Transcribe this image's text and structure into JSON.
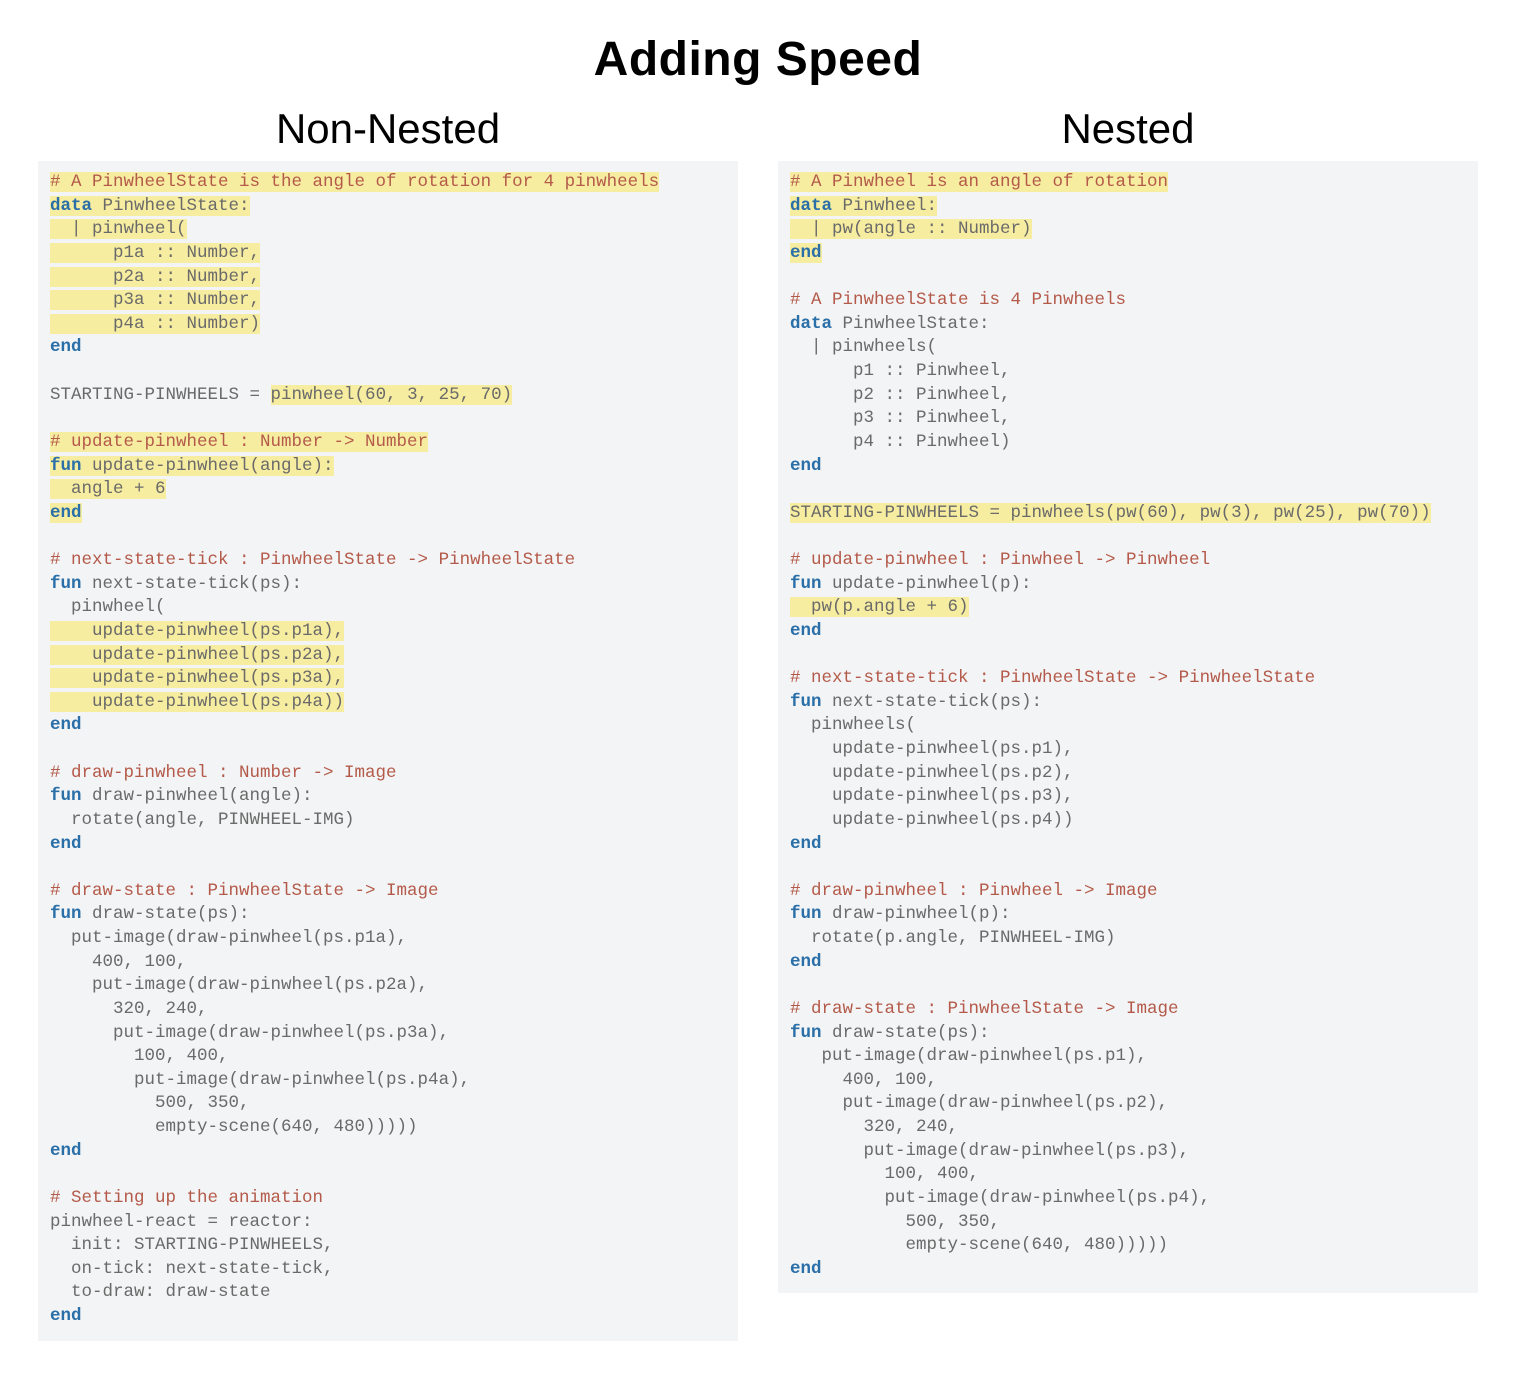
{
  "title": "Adding Speed",
  "left": {
    "heading": "Non-Nested",
    "l01": "# A PinwheelState is the angle of rotation for 4 pinwheels",
    "l02a": "data",
    "l02b": " PinwheelState:",
    "l03": "  | pinwheel(",
    "l04": "      p1a :: Number,",
    "l05": "      p2a :: Number,",
    "l06": "      p3a :: Number,",
    "l07": "      p4a :: Number)",
    "l08": "end",
    "l09a": "STARTING-PINWHEELS = ",
    "l09b": "pinwheel(60, 3, 25, 70)",
    "l10": "# update-pinwheel : Number -> Number",
    "l11a": "fun",
    "l11b": " update-pinwheel(angle):",
    "l12": "  angle + 6",
    "l13": "end",
    "l14": "# next-state-tick : PinwheelState -> PinwheelState",
    "l15a": "fun",
    "l15b": " next-state-tick(ps):",
    "l16": "  pinwheel(",
    "l17": "    update-pinwheel(ps.p1a),",
    "l18": "    update-pinwheel(ps.p2a),",
    "l19": "    update-pinwheel(ps.p3a),",
    "l20": "    update-pinwheel(ps.p4a))",
    "l21": "end",
    "l22": "# draw-pinwheel : Number -> Image",
    "l23a": "fun",
    "l23b": " draw-pinwheel(angle):",
    "l24": "  rotate(angle, PINWHEEL-IMG)",
    "l25": "end",
    "l26": "# draw-state : PinwheelState -> Image",
    "l27a": "fun",
    "l27b": " draw-state(ps):",
    "l28": "  put-image(draw-pinwheel(ps.p1a),",
    "l29": "    400, 100,",
    "l30": "    put-image(draw-pinwheel(ps.p2a),",
    "l31": "      320, 240,",
    "l32": "      put-image(draw-pinwheel(ps.p3a),",
    "l33": "        100, 400,",
    "l34": "        put-image(draw-pinwheel(ps.p4a),",
    "l35": "          500, 350,",
    "l36": "          empty-scene(640, 480)))))",
    "l37": "end",
    "l38": "# Setting up the animation",
    "l39": "pinwheel-react = reactor:",
    "l40": "  init: STARTING-PINWHEELS,",
    "l41": "  on-tick: next-state-tick,",
    "l42": "  to-draw: draw-state",
    "l43": "end"
  },
  "right": {
    "heading": "Nested",
    "l01": "# A Pinwheel is an angle of rotation",
    "l02a": "data",
    "l02b": " Pinwheel:",
    "l03": "  | pw(angle :: Number)",
    "l04": "end",
    "l05": "# A PinwheelState is 4 Pinwheels",
    "l06a": "data",
    "l06b": " PinwheelState:",
    "l07": "  | pinwheels(",
    "l08": "      p1 :: Pinwheel,",
    "l09": "      p2 :: Pinwheel,",
    "l10": "      p3 :: Pinwheel,",
    "l11": "      p4 :: Pinwheel)",
    "l12": "end",
    "l13a": "STARTING-PINWHEELS = ",
    "l13b": "pinwheels(pw(60), pw(3), pw(25), pw(70))",
    "l14": "# update-pinwheel : Pinwheel -> Pinwheel",
    "l15a": "fun",
    "l15b": " update-pinwheel(p):",
    "l16": "  pw(p.angle + 6)",
    "l17": "end",
    "l18": "# next-state-tick : PinwheelState -> PinwheelState",
    "l19a": "fun",
    "l19b": " next-state-tick(ps):",
    "l20": "  pinwheels(",
    "l21": "    update-pinwheel(ps.p1),",
    "l22": "    update-pinwheel(ps.p2),",
    "l23": "    update-pinwheel(ps.p3),",
    "l24": "    update-pinwheel(ps.p4))",
    "l25": "end",
    "l26": "# draw-pinwheel : Pinwheel -> Image",
    "l27a": "fun",
    "l27b": " draw-pinwheel(p):",
    "l28": "  rotate(p.angle, PINWHEEL-IMG)",
    "l29": "end",
    "l30": "# draw-state : PinwheelState -> Image",
    "l31a": "fun",
    "l31b": " draw-state(ps):",
    "l32": "   put-image(draw-pinwheel(ps.p1),",
    "l33": "     400, 100,",
    "l34": "     put-image(draw-pinwheel(ps.p2),",
    "l35": "       320, 240,",
    "l36": "       put-image(draw-pinwheel(ps.p3),",
    "l37": "         100, 400,",
    "l38": "         put-image(draw-pinwheel(ps.p4),",
    "l39": "           500, 350,",
    "l40": "           empty-scene(640, 480)))))",
    "l41": "end"
  }
}
